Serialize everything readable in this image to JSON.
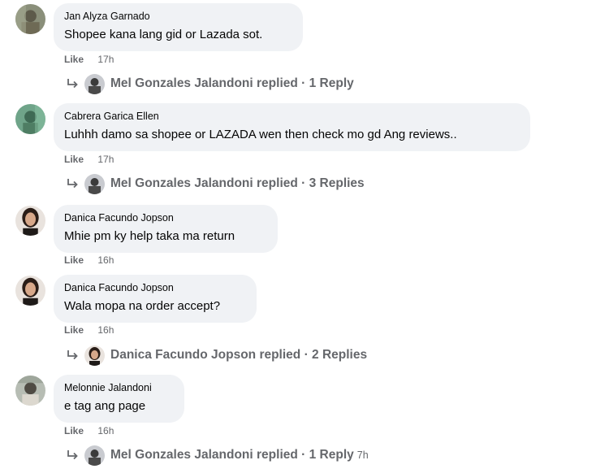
{
  "like_label": "Like",
  "comments": [
    {
      "author": "Jan Alyza Garnado",
      "text": "Shopee kana lang gid or Lazada sot.",
      "time": "17h",
      "reply": {
        "text": "Mel Gonzales Jalandoni replied · 1 Reply",
        "time": ""
      }
    },
    {
      "author": "Cabrera Garica Ellen",
      "text": "Luhhh damo sa shopee or LAZADA wen then check mo gd Ang reviews..",
      "time": "17h",
      "reply": {
        "text": "Mel Gonzales Jalandoni replied · 3 Replies",
        "time": ""
      }
    },
    {
      "author": "Danica Facundo Jopson",
      "text": "Mhie pm ky help taka ma return",
      "time": "16h",
      "reply": null
    },
    {
      "author": "Danica Facundo Jopson",
      "text": "Wala mopa na order accept?",
      "time": "16h",
      "reply": {
        "text": "Danica Facundo Jopson replied · 2 Replies",
        "time": ""
      }
    },
    {
      "author": "Melonnie Jalandoni",
      "text": "e tag ang page",
      "time": "16h",
      "reply": {
        "text": "Mel Gonzales Jalandoni replied · 1 Reply",
        "time": "7h"
      }
    }
  ]
}
